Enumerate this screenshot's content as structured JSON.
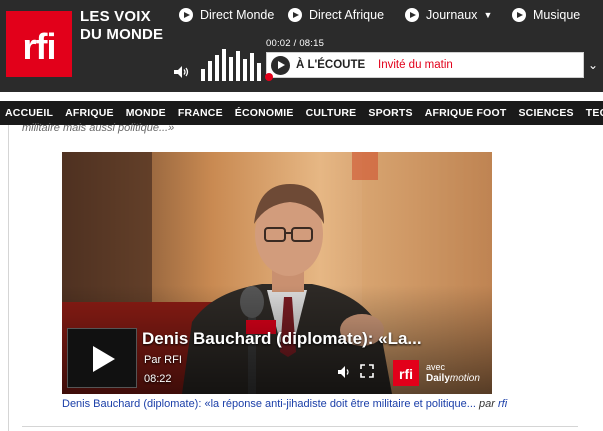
{
  "brand": {
    "logo_text": "rfi",
    "tagline_line1": "LES VOIX",
    "tagline_line2": "DU MONDE",
    "accent_color": "#e2001a"
  },
  "top_nav": [
    {
      "label": "Direct Monde",
      "icon": "play-circle-icon"
    },
    {
      "label": "Direct Afrique",
      "icon": "play-circle-icon"
    },
    {
      "label": "Journaux",
      "icon": "play-circle-icon",
      "has_dropdown": true
    },
    {
      "label": "Musique",
      "icon": "play-circle-icon"
    }
  ],
  "player": {
    "elapsed": "00:02",
    "total": "08:15",
    "time_separator": " / ",
    "status_label": "À L'ÉCOUTE",
    "program": "Invité du matin"
  },
  "main_nav": [
    "ACCUEIL",
    "AFRIQUE",
    "MONDE",
    "FRANCE",
    "ÉCONOMIE",
    "CULTURE",
    "SPORTS",
    "AFRIQUE FOOT",
    "SCIENCES",
    "TECHNO"
  ],
  "article": {
    "snippet": "militaire mais aussi politique...»"
  },
  "video": {
    "title": "Denis Bauchard (diplomate): «La...",
    "author": "Par RFI",
    "duration": "08:22",
    "with_label": "avec",
    "platform_part1": "Daily",
    "platform_part2": "motion",
    "logo_text": "rfi"
  },
  "caption": {
    "text": "Denis Bauchard (diplomate): «la réponse anti-jihadiste doit être militaire et politique...",
    "by": "par",
    "source": "rfi"
  }
}
